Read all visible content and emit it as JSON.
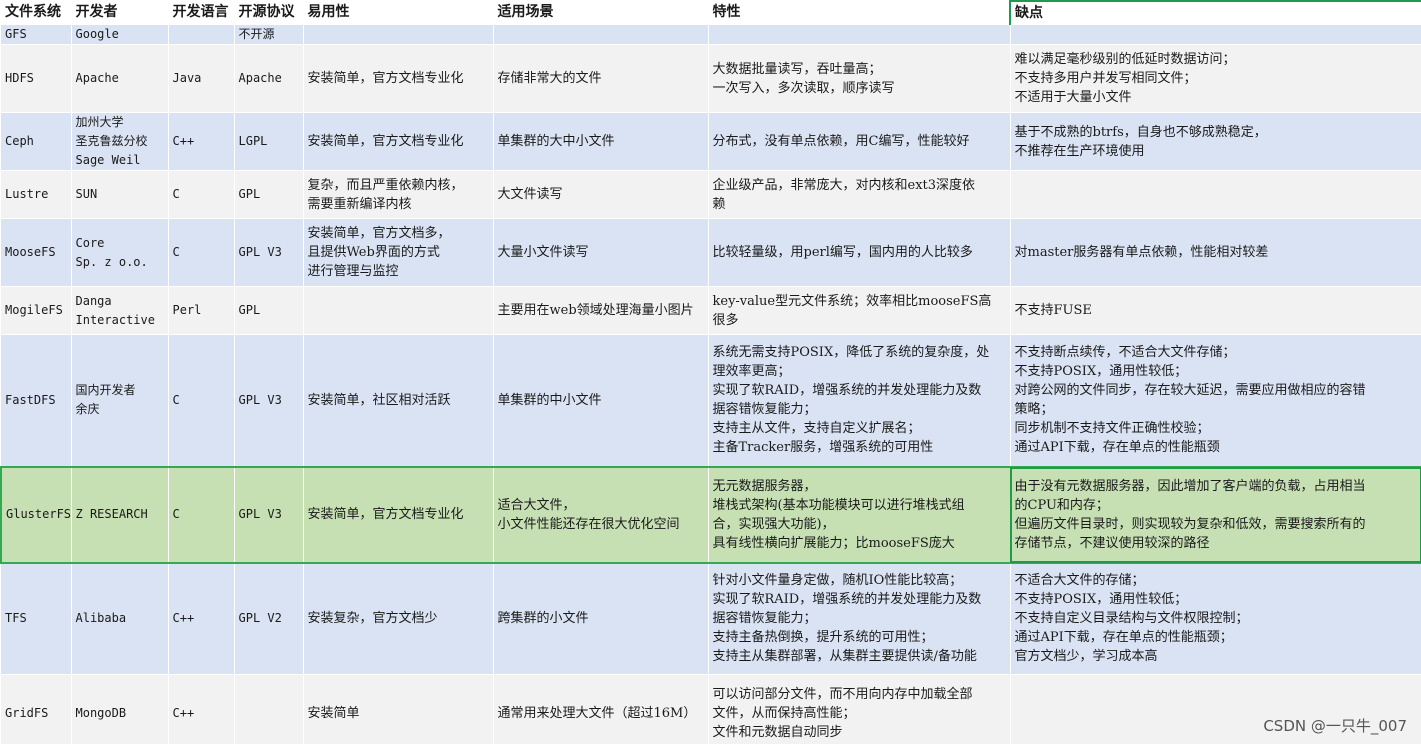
{
  "headers": [
    "文件系统",
    "开发者",
    "开发语言",
    "开源协议",
    "易用性",
    "适用场景",
    "特性",
    "缺点"
  ],
  "rows": [
    {
      "name": "GFS",
      "developer": [
        "Google"
      ],
      "language": "",
      "license": "不开源",
      "usability": [],
      "scenario": [],
      "features": [],
      "drawbacks": []
    },
    {
      "name": "HDFS",
      "developer": [
        "Apache"
      ],
      "language": "Java",
      "license": "Apache",
      "usability": [
        "安装简单，官方文档专业化"
      ],
      "scenario": [
        "存储非常大的文件"
      ],
      "features": [
        "大数据批量读写，吞吐量高；",
        "一次写入，多次读取，顺序读写"
      ],
      "drawbacks": [
        "难以满足毫秒级别的低延时数据访问；",
        "不支持多用户并发写相同文件；",
        "不适用于大量小文件"
      ]
    },
    {
      "name": "Ceph",
      "developer": [
        "加州大学",
        "圣克鲁兹分校",
        "Sage Weil"
      ],
      "language": "C++",
      "license": "LGPL",
      "usability": [
        "安装简单，官方文档专业化"
      ],
      "scenario": [
        "单集群的大中小文件"
      ],
      "features": [
        "分布式，没有单点依赖，用C编写，性能较好"
      ],
      "drawbacks": [
        "基于不成熟的btrfs，自身也不够成熟稳定，",
        "不推荐在生产环境使用"
      ]
    },
    {
      "name": "Lustre",
      "developer": [
        "SUN"
      ],
      "language": "C",
      "license": "GPL",
      "usability": [
        "复杂，而且严重依赖内核，",
        "需要重新编译内核"
      ],
      "scenario": [
        "大文件读写"
      ],
      "features": [
        "企业级产品，非常庞大，对内核和ext3深度依",
        "赖"
      ],
      "drawbacks": []
    },
    {
      "name": "MooseFS",
      "developer": [
        "Core",
        "Sp. z o.o."
      ],
      "language": "C",
      "license": "GPL V3",
      "usability": [
        "安装简单，官方文档多，",
        "且提供Web界面的方式",
        "进行管理与监控"
      ],
      "scenario": [
        "大量小文件读写"
      ],
      "features": [
        "比较轻量级，用perl编写，国内用的人比较多"
      ],
      "drawbacks": [
        "对master服务器有单点依赖，性能相对较差"
      ]
    },
    {
      "name": "MogileFS",
      "developer": [
        "Danga",
        "Interactive"
      ],
      "language": "Perl",
      "license": "GPL",
      "usability": [],
      "scenario": [
        "主要用在web领域处理海量小图片"
      ],
      "features": [
        "key-value型元文件系统；效率相比mooseFS高",
        "很多"
      ],
      "drawbacks": [
        "不支持FUSE"
      ]
    },
    {
      "name": "FastDFS",
      "developer": [
        "国内开发者",
        "余庆"
      ],
      "language": "C",
      "license": "GPL V3",
      "usability": [
        "安装简单，社区相对活跃"
      ],
      "scenario": [
        "单集群的中小文件"
      ],
      "features": [
        "系统无需支持POSIX，降低了系统的复杂度，处",
        "理效率更高；",
        "实现了软RAID，增强系统的并发处理能力及数",
        "据容错恢复能力；",
        "支持主从文件，支持自定义扩展名；",
        "主备Tracker服务，增强系统的可用性"
      ],
      "drawbacks": [
        "不支持断点续传，不适合大文件存储；",
        "不支持POSIX，通用性较低；",
        "对跨公网的文件同步，存在较大延迟，需要应用做相应的容错",
        "策略；",
        "同步机制不支持文件正确性校验；",
        "通过API下载，存在单点的性能瓶颈"
      ]
    },
    {
      "name": "GlusterFS",
      "developer": [
        "Z RESEARCH"
      ],
      "language": "C",
      "license": "GPL V3",
      "usability": [
        "安装简单，官方文档专业化"
      ],
      "scenario": [
        "适合大文件，",
        "小文件性能还存在很大优化空间"
      ],
      "features": [
        "无元数据服务器，",
        "堆栈式架构(基本功能模块可以进行堆栈式组",
        "合，实现强大功能)，",
        "具有线性横向扩展能力；比mooseFS庞大"
      ],
      "drawbacks": [
        "由于没有元数据服务器，因此增加了客户端的负载，占用相当",
        "的CPU和内存；",
        "但遍历文件目录时，则实现较为复杂和低效，需要搜索所有的",
        "存储节点，不建议使用较深的路径"
      ]
    },
    {
      "name": "TFS",
      "developer": [
        "Alibaba"
      ],
      "language": "C++",
      "license": "GPL V2",
      "usability": [
        "安装复杂，官方文档少"
      ],
      "scenario": [
        "跨集群的小文件"
      ],
      "features": [
        "针对小文件量身定做，随机IO性能比较高；",
        "实现了软RAID，增强系统的并发处理能力及数",
        "据容错恢复能力；",
        "支持主备热倒换，提升系统的可用性；",
        "支持主从集群部署，从集群主要提供读/备功能"
      ],
      "drawbacks": [
        "不适合大文件的存储；",
        "不支持POSIX，通用性较低；",
        "不支持自定义目录结构与文件权限控制；",
        "通过API下载，存在单点的性能瓶颈；",
        "官方文档少，学习成本高"
      ]
    },
    {
      "name": "GridFS",
      "developer": [
        "MongoDB"
      ],
      "language": "C++",
      "license": "",
      "usability": [
        "安装简单"
      ],
      "scenario": [
        "通常用来处理大文件（超过16M）"
      ],
      "features": [
        "可以访问部分文件，而不用向内存中加载全部",
        "文件，从而保持高性能；",
        "文件和元数据自动同步"
      ],
      "drawbacks": []
    }
  ],
  "watermark": "CSDN @一只牛_007"
}
